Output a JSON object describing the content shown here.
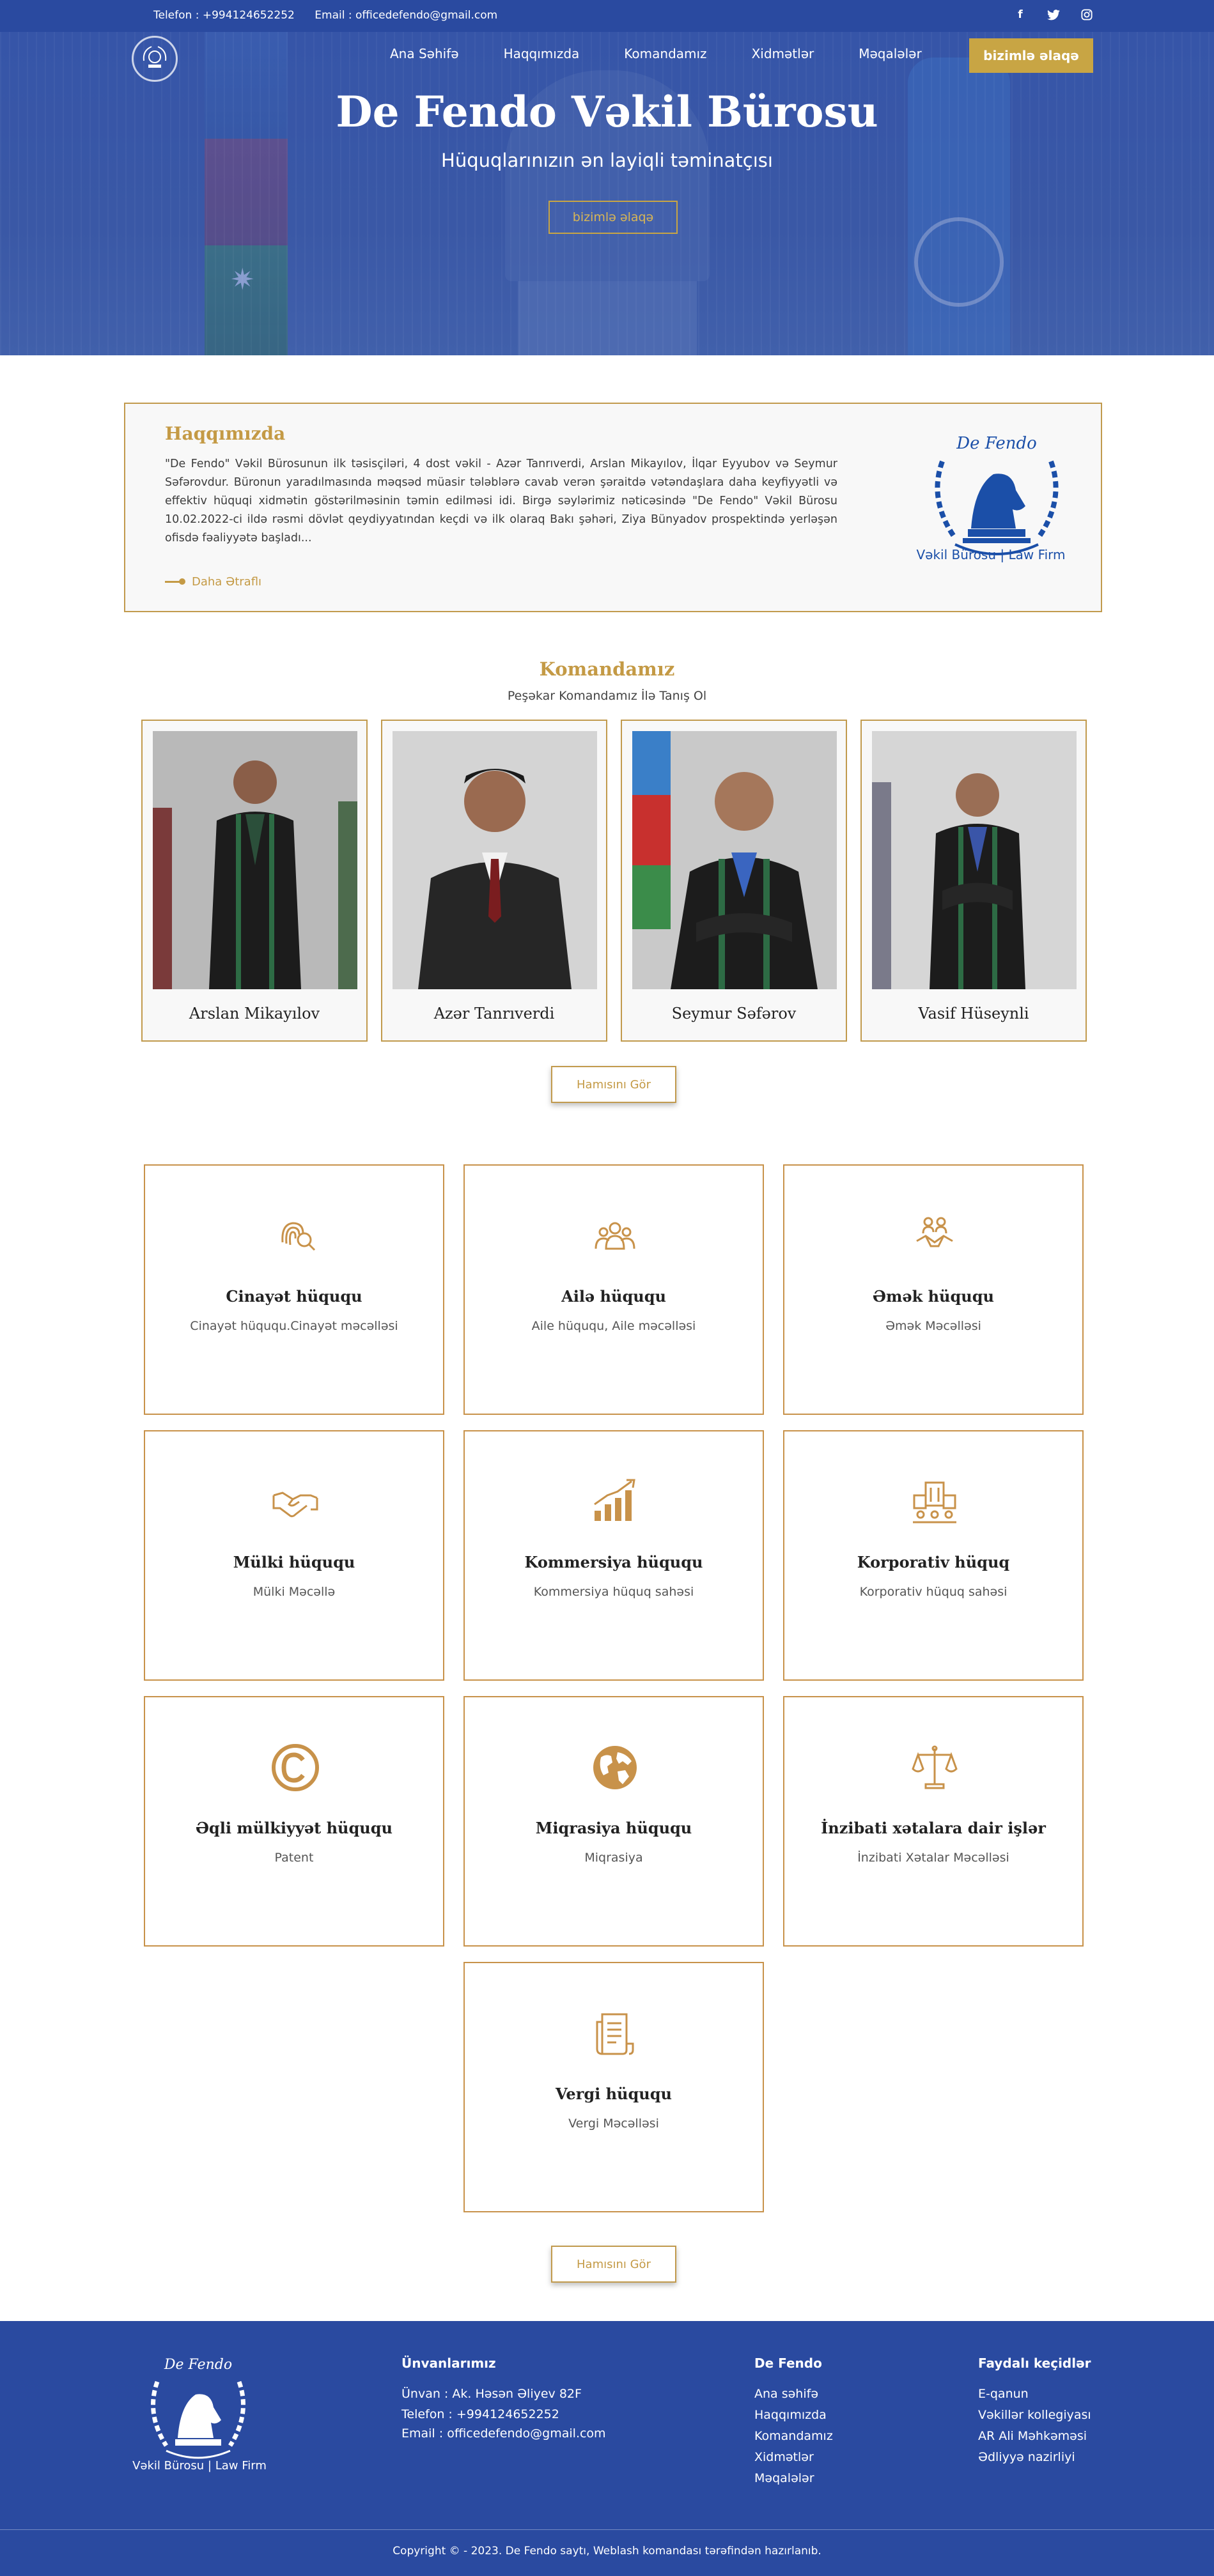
{
  "topbar": {
    "phone": "Telefon : +994124652252",
    "email": "Email : officedefendo@gmail.com",
    "social": [
      {
        "icon": "facebook-icon",
        "glyph": "f"
      },
      {
        "icon": "twitter-icon",
        "glyph": "t"
      },
      {
        "icon": "instagram-icon",
        "glyph": "◎"
      }
    ]
  },
  "nav": {
    "items": [
      "Ana Səhifə",
      "Haqqımızda",
      "Komandamız",
      "Xidmətlər",
      "Məqalələr"
    ],
    "cta": "bizimlə əlaqə"
  },
  "hero": {
    "title": "De Fendo Vəkil Bürosu",
    "subtitle": "Hüquqlarınızın ən layiqli təminatçısı",
    "button": "bizimlə əlaqə"
  },
  "about": {
    "title": "Haqqımızda",
    "text": "\"De Fendo\" Vəkil Bürosunun ilk təsisçiləri, 4 dost vəkil - Azər Tanrıverdi, Arslan Mikayılov, İlqar Eyyubov və Seymur Səfərovdur. Büronun yaradılmasında məqsəd müasir tələblərə cavab verən şəraitdə vətəndaşlara daha keyfiyyətli və effektiv hüquqi xidmətin göstərilməsinin təmin edilməsi idi. Birgə səylərimiz nəticəsində \"De Fendo\" Vəkil Bürosu 10.02.2022-ci ildə rəsmi dövlət qeydiyyatından keçdi və ilk olaraq Bakı şəhəri, Ziya Bünyadov prospektində yerləşən ofisdə fəaliyyətə başladı...",
    "more": "Daha Ətraflı",
    "logo_top": "De Fendo",
    "logo_caption": "Vəkil Bürosu | Law Firm"
  },
  "team": {
    "title": "Komandamız",
    "subtitle": "Peşəkar Komandamız İlə Tanış Ol",
    "members": [
      {
        "name": "Arslan Mikayılov"
      },
      {
        "name": "Azər Tanrıverdi"
      },
      {
        "name": "Seymur Səfərov"
      },
      {
        "name": "Vasif Hüseynli"
      }
    ],
    "see_all": "Hamısını Gör"
  },
  "services": {
    "items": [
      {
        "title": "Cinayət hüququ",
        "desc": "Cinayət hüququ.Cinayət məcəlləsi",
        "icon": "fingerprint-search-icon"
      },
      {
        "title": "Ailə hüququ",
        "desc": "Aile hüququ, Aile məcəlləsi",
        "icon": "family-icon"
      },
      {
        "title": "Əmək hüququ",
        "desc": "Əmək Məcəlləsi",
        "icon": "handshake-people-icon"
      },
      {
        "title": "Mülki hüququ",
        "desc": "Mülki Məcəllə",
        "icon": "handshake-icon"
      },
      {
        "title": "Kommersiya hüququ",
        "desc": "Kommersiya hüquq sahəsi",
        "icon": "growth-chart-icon"
      },
      {
        "title": "Korporativ hüquq",
        "desc": "Korporativ hüquq sahəsi",
        "icon": "corporate-building-icon"
      },
      {
        "title": "Əqli mülkiyyət hüququ",
        "desc": "Patent",
        "icon": "copyright-icon"
      },
      {
        "title": "Miqrasiya hüququ",
        "desc": "Miqrasiya",
        "icon": "globe-icon"
      },
      {
        "title": "İnzibati xətalara dair işlər",
        "desc": "İnzibati Xətalar Məcəlləsi",
        "icon": "scales-icon"
      },
      {
        "title": "Vergi hüququ",
        "desc": "Vergi Məcəlləsi",
        "icon": "tax-document-icon"
      }
    ],
    "see_all": "Hamısını Gör"
  },
  "footer": {
    "logo_top": "De Fendo",
    "logo_caption": "Vəkil Bürosu | Law Firm",
    "address_title": "Ünvanlarımız",
    "address": "Ünvan : Ak. Həsən Əliyev 82F",
    "phone": "Telefon : +994124652252",
    "email": "Email : officedefendo@gmail.com",
    "col2_title": "De Fendo",
    "col2_links": [
      "Ana səhifə",
      "Haqqımızda",
      "Komandamız",
      "Xidmətlər",
      "Məqalələr"
    ],
    "col3_title": "Faydalı keçidlər",
    "col3_links": [
      "E-qanun",
      "Vəkillər kollegiyası",
      "AR Ali Məhkəməsi",
      "Ədliyyə nazirliyi"
    ],
    "copyright": "Copyright © - 2023. De Fendo saytı, Weblash komandası tərəfindən hazırlanıb."
  },
  "colors": {
    "primary_blue": "#2a4aa0",
    "gold": "#c8a544",
    "card_border": "#c19a4d"
  }
}
